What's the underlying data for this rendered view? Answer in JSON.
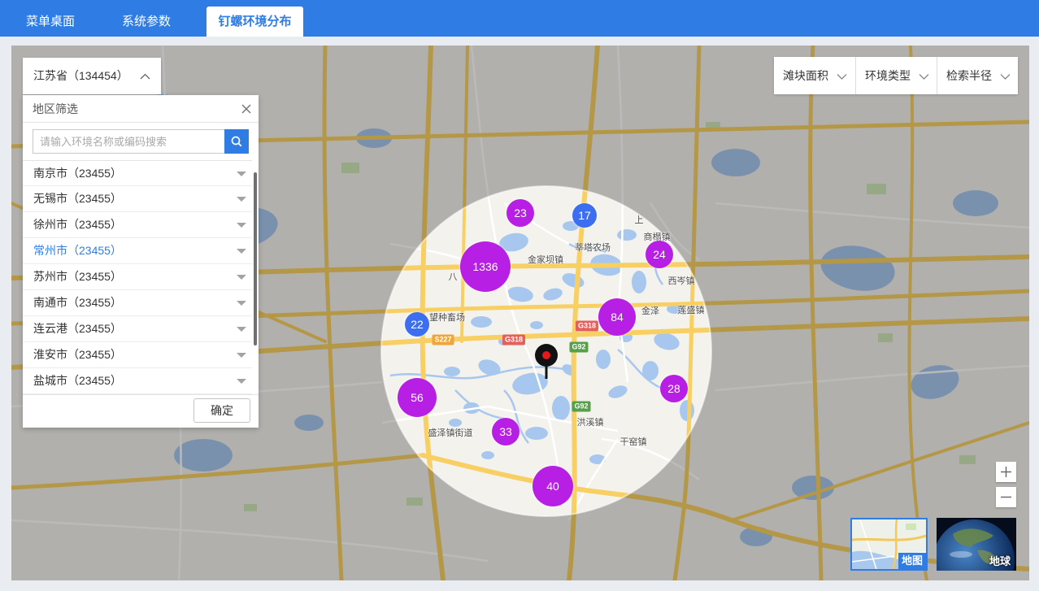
{
  "header": {
    "tabs": [
      {
        "label": "菜单桌面",
        "active": false
      },
      {
        "label": "系统参数",
        "active": false
      },
      {
        "label": "钉螺环境分布",
        "active": true
      }
    ]
  },
  "region_select": {
    "value": "江苏省（134454）",
    "icon": "chevron-up-icon"
  },
  "region_panel": {
    "title": "地区筛选",
    "close_icon": "close-icon",
    "search": {
      "placeholder": "请输入环境名称或编码搜索",
      "value": "",
      "icon": "search-icon"
    },
    "items": [
      {
        "label": "南京市（23455）",
        "selected": false
      },
      {
        "label": "无锡市（23455）",
        "selected": false
      },
      {
        "label": "徐州市（23455）",
        "selected": false
      },
      {
        "label": "常州市（23455）",
        "selected": true
      },
      {
        "label": "苏州市（23455）",
        "selected": false
      },
      {
        "label": "南通市（23455）",
        "selected": false
      },
      {
        "label": "连云港（23455）",
        "selected": false
      },
      {
        "label": "淮安市（23455）",
        "selected": false
      },
      {
        "label": "盐城市（23455）",
        "selected": false
      }
    ],
    "item_icon": "caret-down-icon",
    "confirm_label": "确定"
  },
  "filters": [
    {
      "label": "滩块面积",
      "icon": "chevron-down-icon"
    },
    {
      "label": "环境类型",
      "icon": "chevron-down-icon"
    },
    {
      "label": "检索半径",
      "icon": "chevron-down-icon"
    }
  ],
  "map": {
    "clusters": [
      {
        "count": "23",
        "color": "#b81fe4"
      },
      {
        "count": "17",
        "color": "#3b6ef0"
      },
      {
        "count": "1336",
        "color": "#b81fe4"
      },
      {
        "count": "24",
        "color": "#b81fe4"
      },
      {
        "count": "84",
        "color": "#b81fe4"
      },
      {
        "count": "22",
        "color": "#3b6ef0"
      },
      {
        "count": "56",
        "color": "#b81fe4"
      },
      {
        "count": "28",
        "color": "#b81fe4"
      },
      {
        "count": "33",
        "color": "#b81fe4"
      },
      {
        "count": "40",
        "color": "#b81fe4"
      }
    ],
    "labels": [
      "金家坝镇",
      "莘塔农场",
      "商榻镇",
      "上",
      "八",
      "西岑镇",
      "金泽",
      "莲盛镇",
      "望种畜场",
      "洪溪镇",
      "盛泽镇街道",
      "干窑镇"
    ],
    "road_shields": [
      {
        "text": "G318",
        "color": "#e4605a"
      },
      {
        "text": "G318",
        "color": "#e4605a"
      },
      {
        "text": "G92",
        "color": "#56a04a"
      },
      {
        "text": "G92",
        "color": "#56a04a"
      },
      {
        "text": "S227",
        "color": "#f0a53a"
      }
    ],
    "marker_icon": "location-pin-icon",
    "zoom_icons": [
      "plus-icon",
      "minus-icon"
    ]
  },
  "map_types": [
    {
      "label": "地图",
      "active": true
    },
    {
      "label": "地球",
      "active": false
    }
  ],
  "theme": {
    "primary": "#2f7ce5"
  }
}
